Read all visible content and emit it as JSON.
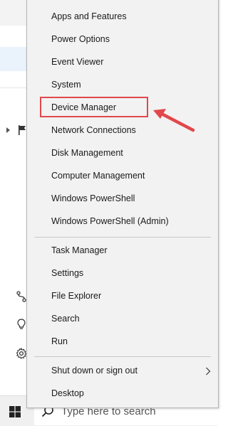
{
  "menu": {
    "items": [
      {
        "label": "Apps and Features"
      },
      {
        "label": "Power Options"
      },
      {
        "label": "Event Viewer"
      },
      {
        "label": "System"
      },
      {
        "label": "Device Manager"
      },
      {
        "label": "Network Connections"
      },
      {
        "label": "Disk Management"
      },
      {
        "label": "Computer Management"
      },
      {
        "label": "Windows PowerShell"
      },
      {
        "label": "Windows PowerShell (Admin)"
      },
      {
        "label": "Task Manager"
      },
      {
        "label": "Settings"
      },
      {
        "label": "File Explorer"
      },
      {
        "label": "Search"
      },
      {
        "label": "Run"
      },
      {
        "label": "Shut down or sign out"
      },
      {
        "label": "Desktop"
      }
    ],
    "highlighted": "Device Manager",
    "highlight_color": "#e2474b"
  },
  "taskbar": {
    "search_placeholder": "Type here to search"
  },
  "icons": {
    "start": "windows-logo-icon",
    "search": "search-icon",
    "submenu": "chevron-right-icon",
    "annotation": "red-arrow-icon"
  }
}
